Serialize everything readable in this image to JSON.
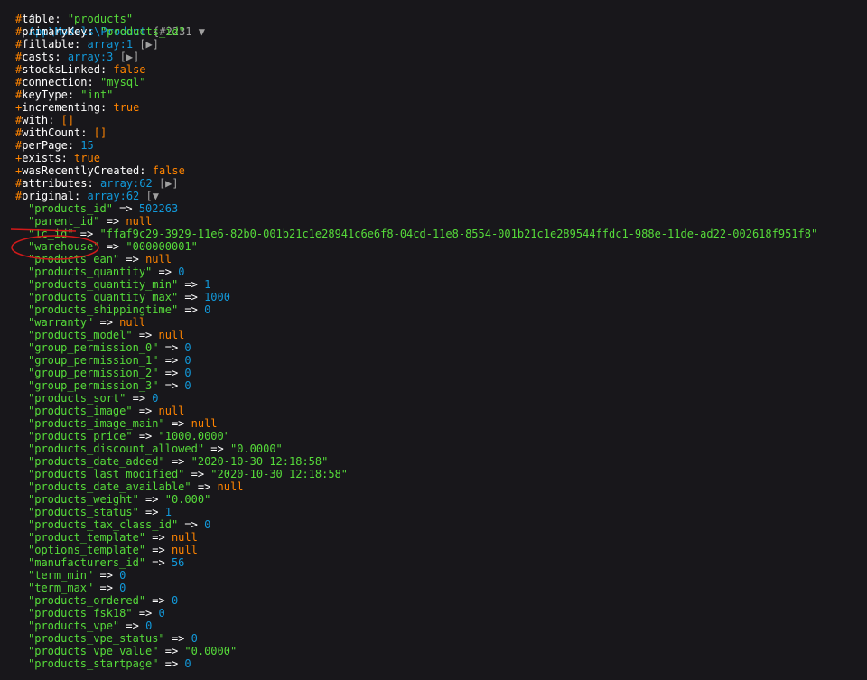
{
  "header": {
    "caret": "^",
    "class_name": "App\\Models\\Product",
    "brace_id": " {#2231",
    "toggle": " ▼"
  },
  "properties": [
    {
      "vis": "#",
      "name": "table",
      "value": "\"products\"",
      "type": "str"
    },
    {
      "vis": "#",
      "name": "primaryKey",
      "value": "\"products_id\"",
      "type": "str"
    },
    {
      "vis": "#",
      "name": "fillable",
      "value": "array:1",
      "toggle": " [▶]",
      "type": "arr"
    },
    {
      "vis": "#",
      "name": "casts",
      "value": "array:3",
      "toggle": " [▶]",
      "type": "arr"
    },
    {
      "vis": "#",
      "name": "stocksLinked",
      "value": "false",
      "type": "const"
    },
    {
      "vis": "#",
      "name": "connection",
      "value": "\"mysql\"",
      "type": "str"
    },
    {
      "vis": "#",
      "name": "keyType",
      "value": "\"int\"",
      "type": "str"
    },
    {
      "vis": "+",
      "name": "incrementing",
      "value": "true",
      "type": "const"
    },
    {
      "vis": "#",
      "name": "with",
      "value": "[]",
      "type": "const"
    },
    {
      "vis": "#",
      "name": "withCount",
      "value": "[]",
      "type": "const"
    },
    {
      "vis": "#",
      "name": "perPage",
      "value": "15",
      "type": "num"
    },
    {
      "vis": "+",
      "name": "exists",
      "value": "true",
      "type": "const"
    },
    {
      "vis": "+",
      "name": "wasRecentlyCreated",
      "value": "false",
      "type": "const"
    },
    {
      "vis": "#",
      "name": "attributes",
      "value": "array:62",
      "toggle": " [▶]",
      "type": "arr"
    },
    {
      "vis": "#",
      "name": "original",
      "value": "array:62",
      "toggle": " [▼",
      "type": "arr"
    }
  ],
  "original_entries": [
    {
      "key": "\"products_id\"",
      "value": "502263",
      "type": "num"
    },
    {
      "key": "\"parent_id\"",
      "value": "null",
      "type": "const"
    },
    {
      "key": "\"1c_id\"",
      "value": "\"ffaf9c29-3929-11e6-82b0-001b21c1e28941c6e6f8-04cd-11e8-8554-001b21c1e289544ffdc1-988e-11de-ad22-002618f951f8\"",
      "type": "str"
    },
    {
      "key": "\"warehouse\"",
      "value": "\"000000001\"",
      "type": "str"
    },
    {
      "key": "\"products_ean\"",
      "value": "null",
      "type": "const"
    },
    {
      "key": "\"products_quantity\"",
      "value": "0",
      "type": "num"
    },
    {
      "key": "\"products_quantity_min\"",
      "value": "1",
      "type": "num"
    },
    {
      "key": "\"products_quantity_max\"",
      "value": "1000",
      "type": "num"
    },
    {
      "key": "\"products_shippingtime\"",
      "value": "0",
      "type": "num"
    },
    {
      "key": "\"warranty\"",
      "value": "null",
      "type": "const"
    },
    {
      "key": "\"products_model\"",
      "value": "null",
      "type": "const"
    },
    {
      "key": "\"group_permission_0\"",
      "value": "0",
      "type": "num"
    },
    {
      "key": "\"group_permission_1\"",
      "value": "0",
      "type": "num"
    },
    {
      "key": "\"group_permission_2\"",
      "value": "0",
      "type": "num"
    },
    {
      "key": "\"group_permission_3\"",
      "value": "0",
      "type": "num"
    },
    {
      "key": "\"products_sort\"",
      "value": "0",
      "type": "num"
    },
    {
      "key": "\"products_image\"",
      "value": "null",
      "type": "const"
    },
    {
      "key": "\"products_image_main\"",
      "value": "null",
      "type": "const"
    },
    {
      "key": "\"products_price\"",
      "value": "\"1000.0000\"",
      "type": "str"
    },
    {
      "key": "\"products_discount_allowed\"",
      "value": "\"0.0000\"",
      "type": "str"
    },
    {
      "key": "\"products_date_added\"",
      "value": "\"2020-10-30 12:18:58\"",
      "type": "str"
    },
    {
      "key": "\"products_last_modified\"",
      "value": "\"2020-10-30 12:18:58\"",
      "type": "str"
    },
    {
      "key": "\"products_date_available\"",
      "value": "null",
      "type": "const"
    },
    {
      "key": "\"products_weight\"",
      "value": "\"0.000\"",
      "type": "str"
    },
    {
      "key": "\"products_status\"",
      "value": "1",
      "type": "num"
    },
    {
      "key": "\"products_tax_class_id\"",
      "value": "0",
      "type": "num"
    },
    {
      "key": "\"product_template\"",
      "value": "null",
      "type": "const"
    },
    {
      "key": "\"options_template\"",
      "value": "null",
      "type": "const"
    },
    {
      "key": "\"manufacturers_id\"",
      "value": "56",
      "type": "num"
    },
    {
      "key": "\"term_min\"",
      "value": "0",
      "type": "num"
    },
    {
      "key": "\"term_max\"",
      "value": "0",
      "type": "num"
    },
    {
      "key": "\"products_ordered\"",
      "value": "0",
      "type": "num"
    },
    {
      "key": "\"products_fsk18\"",
      "value": "0",
      "type": "num"
    },
    {
      "key": "\"products_vpe\"",
      "value": "0",
      "type": "num"
    },
    {
      "key": "\"products_vpe_status\"",
      "value": "0",
      "type": "num"
    },
    {
      "key": "\"products_vpe_value\"",
      "value": "\"0.0000\"",
      "type": "str"
    },
    {
      "key": "\"products_startpage\"",
      "value": "0",
      "type": "num"
    }
  ],
  "separators": {
    "colon": ": ",
    "arrow": " => "
  },
  "colors": {
    "background": "#18171b",
    "string": "#56db3a",
    "number": "#1299da",
    "constant": "#ff8400",
    "annotation": "#d11a1a"
  }
}
